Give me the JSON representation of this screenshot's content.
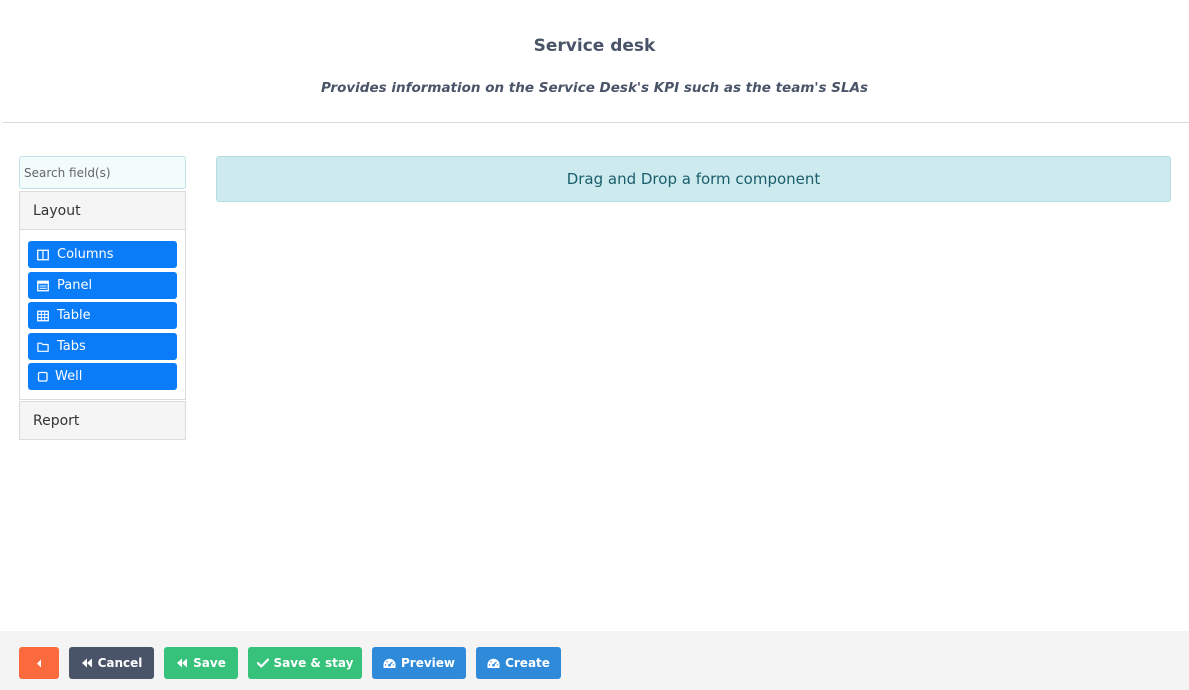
{
  "header": {
    "title": "Service desk",
    "subtitle": "Provides information on the Service Desk's KPI such as the team's SLAs"
  },
  "sidebar": {
    "search": {
      "value": "",
      "placeholder": "Search field(s)"
    },
    "groups": [
      {
        "label": "Layout",
        "expanded": true,
        "items": [
          {
            "label": "Columns",
            "icon": "columns-icon"
          },
          {
            "label": "Panel",
            "icon": "panel-icon"
          },
          {
            "label": "Table",
            "icon": "table-icon"
          },
          {
            "label": "Tabs",
            "icon": "folder-icon"
          },
          {
            "label": "Well",
            "icon": "square-icon"
          }
        ]
      },
      {
        "label": "Report",
        "expanded": false
      }
    ]
  },
  "main": {
    "dropzone_text": "Drag and Drop a form component"
  },
  "footer": {
    "back_icon": "caret-left-icon",
    "cancel_label": "Cancel",
    "save_label": "Save",
    "save_stay_label": "Save & stay",
    "preview_label": "Preview",
    "create_label": "Create"
  },
  "colors": {
    "component_blue": "#0a7cf8",
    "back_orange": "#fa6a3c",
    "cancel_slate": "#4a5468",
    "save_green": "#36c27a",
    "action_blue": "#2f8ad9",
    "dropzone_bg": "#cdebef"
  }
}
